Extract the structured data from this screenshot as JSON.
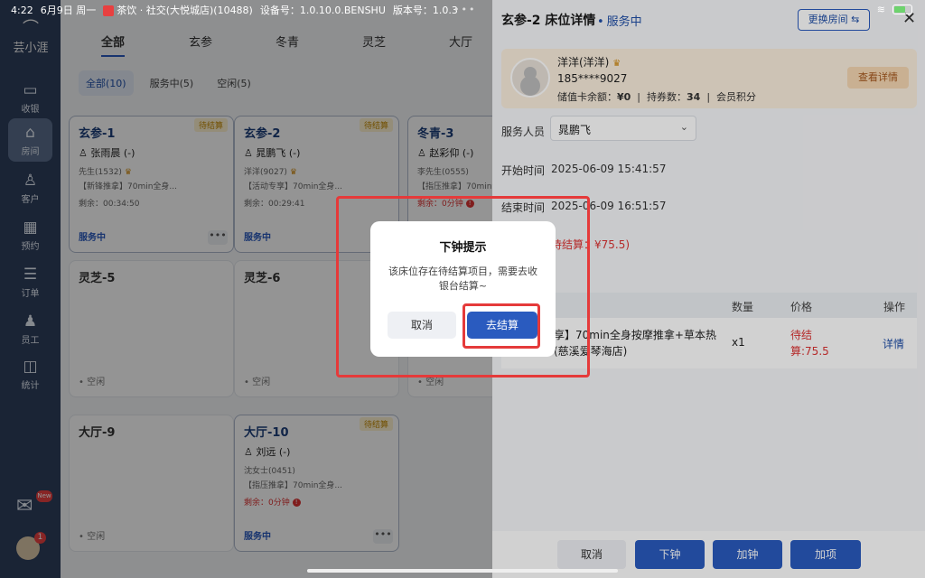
{
  "statusbar": {
    "time": "4:22",
    "date": "6月9日 周一",
    "store": "茶饮 · 社交(大悦城店)(10488)",
    "device": "设备号：1.0.10.0.BENSHU",
    "version": "版本号：1.0.3",
    "dots": "•••"
  },
  "sidebar": {
    "logo": "芸小涯",
    "items": [
      {
        "label": "收银",
        "icon": "monitor-icon"
      },
      {
        "label": "房间",
        "icon": "home-icon"
      },
      {
        "label": "客户",
        "icon": "user-icon"
      },
      {
        "label": "预约",
        "icon": "calendar-icon"
      },
      {
        "label": "订单",
        "icon": "list-icon"
      },
      {
        "label": "员工",
        "icon": "staff-icon"
      },
      {
        "label": "统计",
        "icon": "chart-icon"
      }
    ],
    "bell_badge": "New",
    "avatar_badge": "1"
  },
  "main": {
    "tabs": [
      "全部",
      "玄参",
      "冬青",
      "灵芝",
      "大厅"
    ],
    "filters": [
      "全部(10)",
      "服务中(5)",
      "空闲(5)"
    ],
    "cards": [
      {
        "room": "玄参-1",
        "tag": "待结算",
        "staff": "张雨晨 (-)",
        "guest": "先生(1532)",
        "item": "【新锋推拿】70min全身...",
        "remain": "剩余：00:34:50",
        "status": "服务中",
        "more": "•••"
      },
      {
        "room": "玄参-2",
        "tag": "待结算",
        "staff": "晁鹏飞 (-)",
        "guest": "洋洋(9027)",
        "item": "【活动专享】70min全身...",
        "remain": "剩余：00:29:41",
        "status": "服务中",
        "more": "•••"
      },
      {
        "room": "冬青-3",
        "tag": "",
        "staff": "赵彩仰 (-)",
        "guest": "李先生(0555)",
        "item": "【指压推拿】70min全身...",
        "remain": "剩余：0分钟",
        "status": "",
        "more": ""
      },
      {
        "room": "灵芝-5",
        "status": "空闲"
      },
      {
        "room": "灵芝-6",
        "status": "空闲"
      },
      {
        "room": "",
        "status": "空闲"
      },
      {
        "room": "大厅-9",
        "status": "空闲"
      },
      {
        "room": "大厅-10",
        "tag": "待结算",
        "staff": "刘远 (-)",
        "guest": "沈女士(0451)",
        "item": "【指压推拿】70min全身...",
        "remain": "剩余：0分钟",
        "status": "服务中",
        "more": "•••"
      }
    ]
  },
  "drawer": {
    "title": "玄参-2 床位详情",
    "state": "服务中",
    "switch_label": "更换房间 ⇆",
    "close": "✕",
    "member": {
      "name": "洋洋(洋洋)",
      "phone": "185****9027",
      "stats_label1": "储值卡余额：",
      "balance": "¥0",
      "stats_label2": "持券数：",
      "coupons": "34",
      "stats_label3": "会员积分",
      "detail_button": "查看详情"
    },
    "staff_label": "服务人员",
    "staff_value": "晁鹏飞",
    "start_label": "开始时间",
    "start_value": "2025-06-09 15:41:57",
    "end_label": "结束时间",
    "end_value": "2025-06-09 16:51:57",
    "pending": "待结算：¥75.5)",
    "table": {
      "headers": [
        "数量",
        "价格",
        "操作"
      ],
      "row": {
        "item": "享】70min全身按摩推拿+草本热",
        "store": "(慈溪爱琴海店)",
        "qty": "x1",
        "price1": "待结",
        "price2": "算:75.5",
        "action": "详情"
      }
    },
    "footer": [
      "取消",
      "下钟",
      "加钟",
      "加项"
    ]
  },
  "modal": {
    "title": "下钟提示",
    "message": "该床位存在待结算项目，需要去收银台结算~",
    "cancel": "取消",
    "confirm": "去结算"
  },
  "colors": {
    "sidebar": "#2d3e5c",
    "primary": "#2a5bbf",
    "highlight": "#e53a3a",
    "pending": "#d33333"
  }
}
